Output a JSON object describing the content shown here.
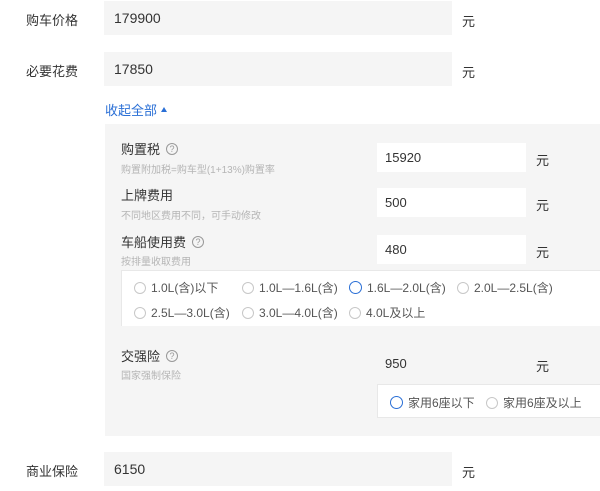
{
  "car_price": {
    "label": "购车价格",
    "value": "179900",
    "unit": "元"
  },
  "required_cost": {
    "label": "必要花费",
    "value": "17850",
    "unit": "元"
  },
  "collapse_label": "收起全部",
  "purchase_tax": {
    "title": "购置税",
    "note": "购置附加税=购车型(1+13%)购置率",
    "value": "15920",
    "unit": "元"
  },
  "license_fee": {
    "title": "上牌费用",
    "note": "不同地区费用不同，可手动修改",
    "value": "500",
    "unit": "元"
  },
  "vehicle_tax": {
    "title": "车船使用费",
    "note": "按排量收取费用",
    "value": "480",
    "unit": "元",
    "options": [
      "1.0L(含)以下",
      "1.0L—1.6L(含)",
      "1.6L—2.0L(含)",
      "2.0L—2.5L(含)",
      "2.5L—3.0L(含)",
      "3.0L—4.0L(含)",
      "4.0L及以上"
    ],
    "selected": 2
  },
  "compulsory_insurance": {
    "title": "交强险",
    "note": "国家强制保险",
    "value": "950",
    "unit": "元",
    "options": [
      "家用6座以下",
      "家用6座及以上"
    ],
    "selected": 0
  },
  "commercial_insurance": {
    "label": "商业保险",
    "value": "6150",
    "unit": "元"
  },
  "colors": {
    "accent": "#2a6fd6",
    "panel_bg": "#f5f5f5",
    "note_text": "#b5b5b5"
  }
}
